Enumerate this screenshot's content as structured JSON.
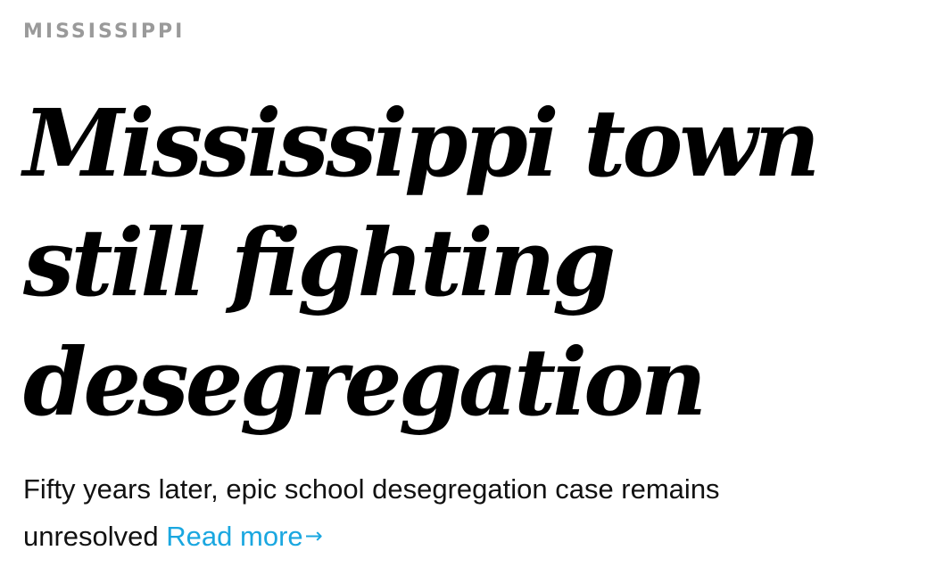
{
  "kicker": "MISSISSIPPI",
  "headline": {
    "line1": "Mississippi town",
    "line2": "still fighting",
    "line3": "desegregation"
  },
  "dek": {
    "text": "Fifty years later, epic school desegregation case remains unresolved",
    "read_more_label": "Read more",
    "read_more_icon": "arrow-right-icon"
  },
  "colors": {
    "kicker": "#9a9a9a",
    "headline": "#000000",
    "body": "#111111",
    "link": "#1aa7e0"
  }
}
